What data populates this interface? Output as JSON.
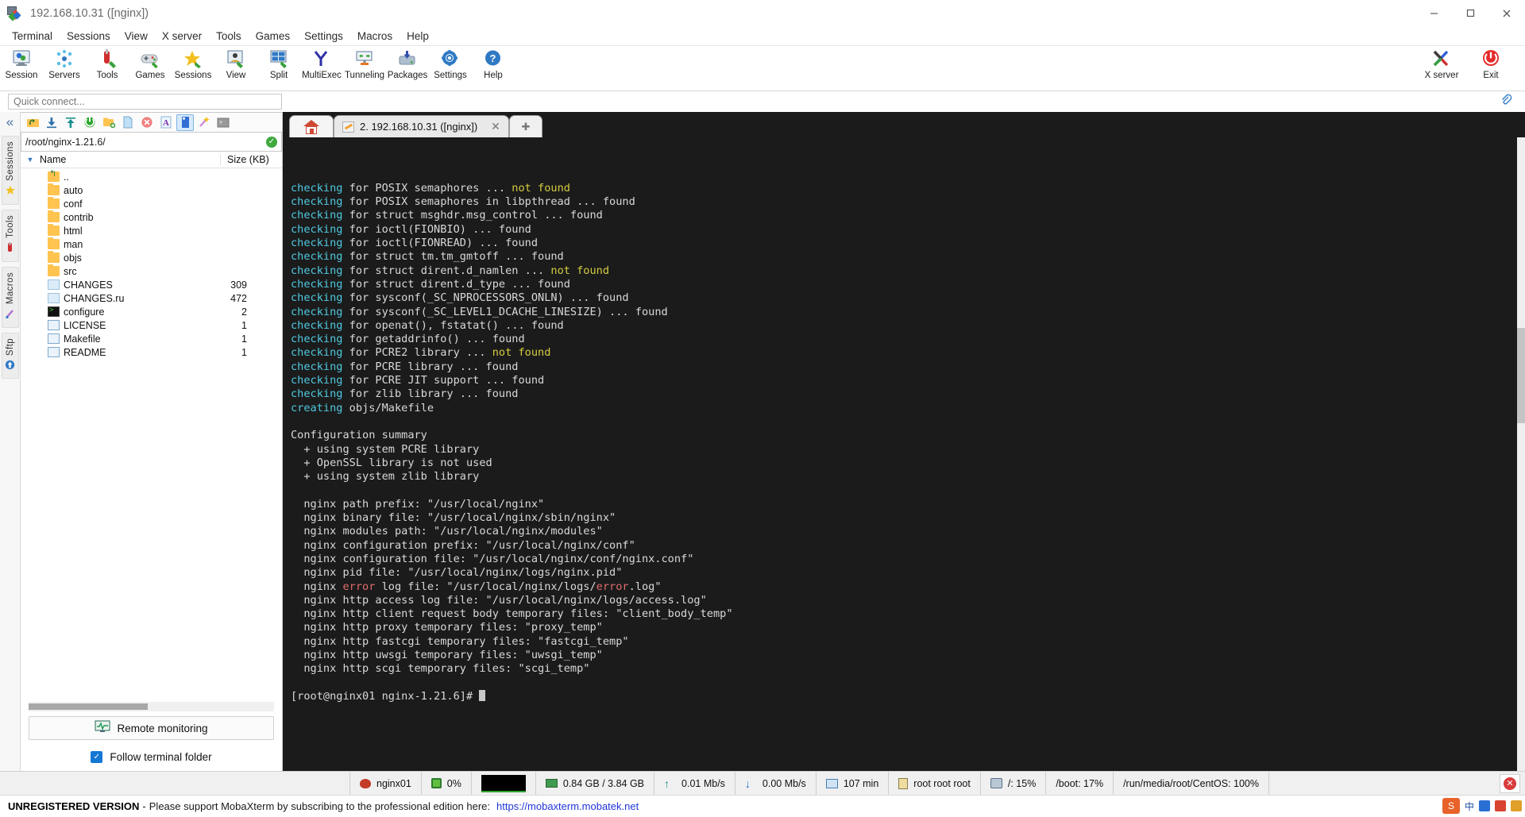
{
  "window": {
    "title": "192.168.10.31 ([nginx])",
    "minimize": "–",
    "maximize": "❑",
    "close": "✕"
  },
  "menubar": {
    "items": [
      "Terminal",
      "Sessions",
      "View",
      "X server",
      "Tools",
      "Games",
      "Settings",
      "Macros",
      "Help"
    ]
  },
  "ribbon": {
    "items": [
      {
        "label": "Session",
        "icon": "session-icon"
      },
      {
        "label": "Servers",
        "icon": "servers-icon"
      },
      {
        "label": "Tools",
        "icon": "tools-icon"
      },
      {
        "label": "Games",
        "icon": "games-icon"
      },
      {
        "label": "Sessions",
        "icon": "star-icon"
      },
      {
        "label": "View",
        "icon": "view-icon"
      },
      {
        "label": "Split",
        "icon": "split-icon"
      },
      {
        "label": "MultiExec",
        "icon": "multiexec-icon"
      },
      {
        "label": "Tunneling",
        "icon": "tunneling-icon"
      },
      {
        "label": "Packages",
        "icon": "packages-icon"
      },
      {
        "label": "Settings",
        "icon": "settings-gear-icon"
      },
      {
        "label": "Help",
        "icon": "help-icon"
      }
    ],
    "right": [
      {
        "label": "X server",
        "icon": "xserver-icon"
      },
      {
        "label": "Exit",
        "icon": "power-icon"
      }
    ]
  },
  "quick_connect": {
    "placeholder": "Quick connect..."
  },
  "rail": {
    "collapse": "«",
    "groups": [
      {
        "label": "Sessions",
        "icon": "star-icon"
      },
      {
        "label": "Tools",
        "icon": "tools-icon"
      },
      {
        "label": "Macros",
        "icon": "macro-icon"
      },
      {
        "label": "Sftp",
        "icon": "sftp-icon"
      }
    ]
  },
  "sidebar": {
    "toolbar_buttons": [
      {
        "name": "go-up-icon"
      },
      {
        "name": "download-icon"
      },
      {
        "name": "upload-icon"
      },
      {
        "name": "refresh-icon"
      },
      {
        "name": "new-folder-icon"
      },
      {
        "name": "new-file-icon"
      },
      {
        "name": "delete-icon"
      },
      {
        "name": "text-mode-icon"
      },
      {
        "name": "binary-mode-icon"
      },
      {
        "name": "magic-icon"
      },
      {
        "name": "terminal-icon"
      }
    ],
    "path": "/root/nginx-1.21.6/",
    "path_status": "✓",
    "columns": {
      "name": "Name",
      "size": "Size (KB)"
    },
    "files": [
      {
        "name": "..",
        "size": "",
        "type": "up"
      },
      {
        "name": "auto",
        "size": "",
        "type": "folder"
      },
      {
        "name": "conf",
        "size": "",
        "type": "folder"
      },
      {
        "name": "contrib",
        "size": "",
        "type": "folder"
      },
      {
        "name": "html",
        "size": "",
        "type": "folder"
      },
      {
        "name": "man",
        "size": "",
        "type": "folder"
      },
      {
        "name": "objs",
        "size": "",
        "type": "folder"
      },
      {
        "name": "src",
        "size": "",
        "type": "folder"
      },
      {
        "name": "CHANGES",
        "size": "309",
        "type": "doc"
      },
      {
        "name": "CHANGES.ru",
        "size": "472",
        "type": "doc"
      },
      {
        "name": "configure",
        "size": "2",
        "type": "term"
      },
      {
        "name": "LICENSE",
        "size": "1",
        "type": "txt"
      },
      {
        "name": "Makefile",
        "size": "1",
        "type": "txt"
      },
      {
        "name": "README",
        "size": "1",
        "type": "txt"
      }
    ],
    "remote_monitoring": "Remote monitoring",
    "follow_terminal_folder": "Follow terminal folder",
    "follow_checked": "✓"
  },
  "tabs": {
    "home_label": "",
    "active": "2. 192.168.10.31 ([nginx])",
    "close_glyph": "✕",
    "new_tab_glyph": "✚"
  },
  "terminal": {
    "lines": [
      [
        {
          "t": "checking",
          "c": "cyan"
        },
        {
          "t": " for POSIX semaphores ... ",
          "c": "white"
        },
        {
          "t": "not found",
          "c": "yellow"
        }
      ],
      [
        {
          "t": "checking",
          "c": "cyan"
        },
        {
          "t": " for POSIX semaphores in libpthread ... found",
          "c": "white"
        }
      ],
      [
        {
          "t": "checking",
          "c": "cyan"
        },
        {
          "t": " for struct msghdr.msg_control ... found",
          "c": "white"
        }
      ],
      [
        {
          "t": "checking",
          "c": "cyan"
        },
        {
          "t": " for ioctl(FIONBIO) ... found",
          "c": "white"
        }
      ],
      [
        {
          "t": "checking",
          "c": "cyan"
        },
        {
          "t": " for ioctl(FIONREAD) ... found",
          "c": "white"
        }
      ],
      [
        {
          "t": "checking",
          "c": "cyan"
        },
        {
          "t": " for struct tm.tm_gmtoff ... found",
          "c": "white"
        }
      ],
      [
        {
          "t": "checking",
          "c": "cyan"
        },
        {
          "t": " for struct dirent.d_namlen ... ",
          "c": "white"
        },
        {
          "t": "not found",
          "c": "yellow"
        }
      ],
      [
        {
          "t": "checking",
          "c": "cyan"
        },
        {
          "t": " for struct dirent.d_type ... found",
          "c": "white"
        }
      ],
      [
        {
          "t": "checking",
          "c": "cyan"
        },
        {
          "t": " for sysconf(_SC_NPROCESSORS_ONLN) ... found",
          "c": "white"
        }
      ],
      [
        {
          "t": "checking",
          "c": "cyan"
        },
        {
          "t": " for sysconf(_SC_LEVEL1_DCACHE_LINESIZE) ... found",
          "c": "white"
        }
      ],
      [
        {
          "t": "checking",
          "c": "cyan"
        },
        {
          "t": " for openat(), fstatat() ... found",
          "c": "white"
        }
      ],
      [
        {
          "t": "checking",
          "c": "cyan"
        },
        {
          "t": " for getaddrinfo() ... found",
          "c": "white"
        }
      ],
      [
        {
          "t": "checking",
          "c": "cyan"
        },
        {
          "t": " for PCRE2 library ... ",
          "c": "white"
        },
        {
          "t": "not found",
          "c": "yellow"
        }
      ],
      [
        {
          "t": "checking",
          "c": "cyan"
        },
        {
          "t": " for PCRE library ... found",
          "c": "white"
        }
      ],
      [
        {
          "t": "checking",
          "c": "cyan"
        },
        {
          "t": " for PCRE JIT support ... found",
          "c": "white"
        }
      ],
      [
        {
          "t": "checking",
          "c": "cyan"
        },
        {
          "t": " for zlib library ... found",
          "c": "white"
        }
      ],
      [
        {
          "t": "creating",
          "c": "cyan"
        },
        {
          "t": " objs/Makefile",
          "c": "white"
        }
      ],
      [
        {
          "t": "",
          "c": "white"
        }
      ],
      [
        {
          "t": "Configuration summary",
          "c": "white"
        }
      ],
      [
        {
          "t": "  + using system PCRE library",
          "c": "white"
        }
      ],
      [
        {
          "t": "  + OpenSSL library is not used",
          "c": "white"
        }
      ],
      [
        {
          "t": "  + using system zlib library",
          "c": "white"
        }
      ],
      [
        {
          "t": "",
          "c": "white"
        }
      ],
      [
        {
          "t": "  nginx path prefix: \"/usr/local/nginx\"",
          "c": "white"
        }
      ],
      [
        {
          "t": "  nginx binary file: \"/usr/local/nginx/sbin/nginx\"",
          "c": "white"
        }
      ],
      [
        {
          "t": "  nginx modules path: \"/usr/local/nginx/modules\"",
          "c": "white"
        }
      ],
      [
        {
          "t": "  nginx configuration prefix: \"/usr/local/nginx/conf\"",
          "c": "white"
        }
      ],
      [
        {
          "t": "  nginx configuration file: \"/usr/local/nginx/conf/nginx.conf\"",
          "c": "white"
        }
      ],
      [
        {
          "t": "  nginx pid file: \"/usr/local/nginx/logs/nginx.pid\"",
          "c": "white"
        }
      ],
      [
        {
          "t": "  nginx ",
          "c": "white"
        },
        {
          "t": "error",
          "c": "red"
        },
        {
          "t": " log file: \"/usr/local/nginx/logs/",
          "c": "white"
        },
        {
          "t": "error",
          "c": "red"
        },
        {
          "t": ".log\"",
          "c": "white"
        }
      ],
      [
        {
          "t": "  nginx http access log file: \"/usr/local/nginx/logs/access.log\"",
          "c": "white"
        }
      ],
      [
        {
          "t": "  nginx http client request body temporary files: \"client_body_temp\"",
          "c": "white"
        }
      ],
      [
        {
          "t": "  nginx http proxy temporary files: \"proxy_temp\"",
          "c": "white"
        }
      ],
      [
        {
          "t": "  nginx http fastcgi temporary files: \"fastcgi_temp\"",
          "c": "white"
        }
      ],
      [
        {
          "t": "  nginx http uwsgi temporary files: \"uwsgi_temp\"",
          "c": "white"
        }
      ],
      [
        {
          "t": "  nginx http scgi temporary files: \"scgi_temp\"",
          "c": "white"
        }
      ],
      [
        {
          "t": "",
          "c": "white"
        }
      ],
      [
        {
          "t": "[root@nginx01 nginx-1.21.6]# ",
          "c": "white"
        }
      ]
    ]
  },
  "statusbar": {
    "host": "nginx01",
    "cpu": "0%",
    "memory": "0.84 GB / 3.84 GB",
    "upload": "0.01 Mb/s",
    "download": "0.00 Mb/s",
    "uptime": "107 min",
    "users": "root  root  root",
    "disk_root": "/: 15%",
    "disk_boot": "/boot: 17%",
    "disk_media": "/run/media/root/CentOS: 100%",
    "close_glyph": "✕"
  },
  "footer": {
    "unregistered": "UNREGISTERED VERSION",
    "dash": "-",
    "message": "Please support MobaXterm by subscribing to the professional edition here:",
    "link": "https://mobaxterm.mobatek.net"
  },
  "ime": {
    "badge": "S",
    "label": "中"
  },
  "colors": {
    "accent": "#1577d4",
    "terminal_bg": "#1b1b1b",
    "cyan": "#4ec9e0",
    "yellow": "#d6cd42",
    "red": "#e06c6c",
    "link": "#2035d8"
  }
}
